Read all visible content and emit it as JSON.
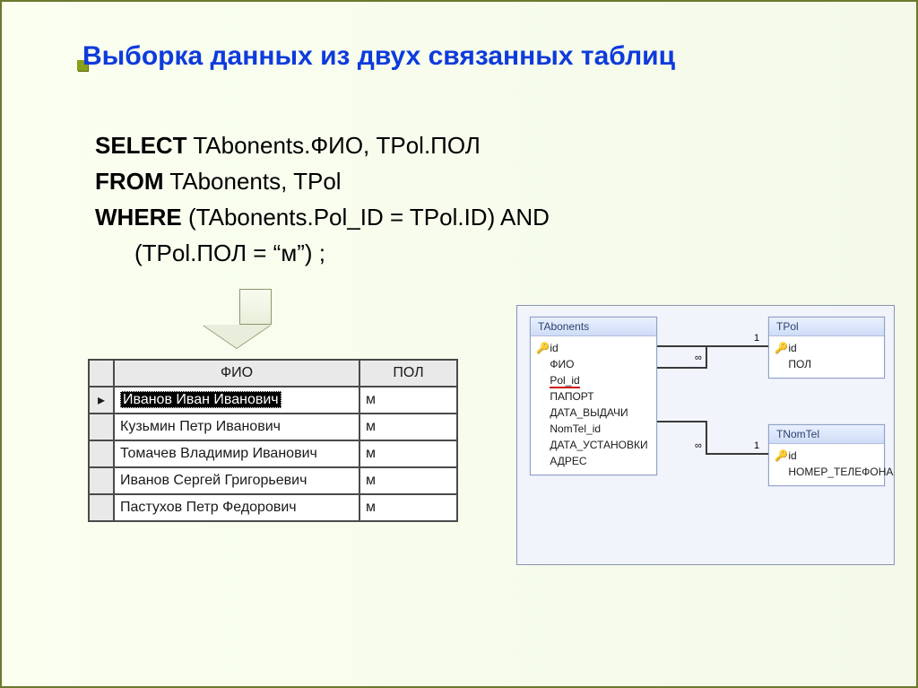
{
  "slide": {
    "title": "Выборка данных из двух связанных таблиц"
  },
  "sql": {
    "select_kw": "SELECT",
    "select_rest": " TAbonents.ФИО, TPol.ПОЛ",
    "from_kw": "FROM",
    "from_rest": " TAbonents, TPol",
    "where_kw": " WHERE",
    "where_rest": " (TAbonents.Pol_ID = TPol.ID) AND",
    "where_rest2": "(TPol.ПОЛ = “м”) ;"
  },
  "result_table": {
    "headers": [
      "ФИО",
      "ПОЛ"
    ],
    "rows": [
      {
        "cursor": "▸",
        "fio": "Иванов Иван Иванович",
        "pol": "м",
        "selected": true
      },
      {
        "cursor": "",
        "fio": "Кузьмин Петр Иванович",
        "pol": "м",
        "selected": false
      },
      {
        "cursor": "",
        "fio": "Томачев Владимир Иванович",
        "pol": "м",
        "selected": false
      },
      {
        "cursor": "",
        "fio": "Иванов Сергей Григорьевич",
        "pol": "м",
        "selected": false
      },
      {
        "cursor": "",
        "fio": "Пастухов Петр Федорович",
        "pol": "м",
        "selected": false
      }
    ]
  },
  "schema": {
    "abonents": {
      "title": "TAbonents",
      "fields": [
        "id",
        "ФИО",
        "Pol_id",
        "ПАПОРТ",
        "ДАТА_ВЫДАЧИ",
        "NomTel_id",
        "ДАТА_УСТАНОВКИ",
        "АДРЕС"
      ],
      "key_field": "id",
      "fk_field": "Pol_id"
    },
    "tpol": {
      "title": "TPol",
      "fields": [
        "id",
        "ПОЛ"
      ],
      "key_field": "id"
    },
    "tnomtel": {
      "title": "TNomTel",
      "fields": [
        "id",
        "НОМЕР_ТЕЛЕФОНА"
      ],
      "key_field": "id"
    },
    "link_labels": {
      "many": "∞",
      "one": "1"
    }
  }
}
